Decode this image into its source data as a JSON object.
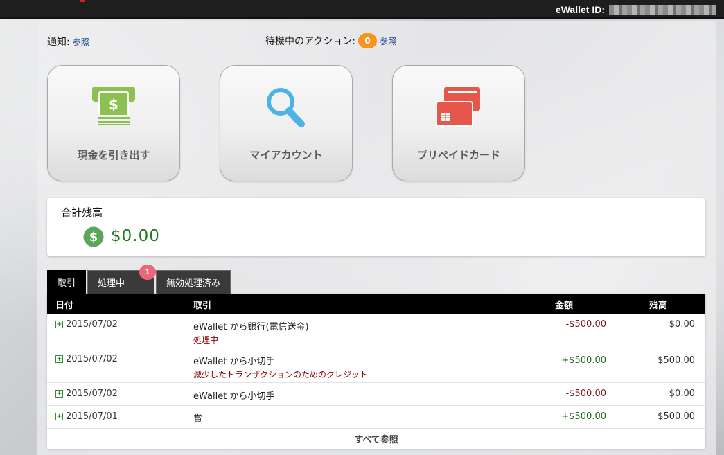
{
  "header": {
    "ewallet_id_label": "eWallet ID:"
  },
  "notices": {
    "notice_label": "通知:",
    "notice_link": "参照",
    "pending_label": "待機中のアクション:",
    "pending_count": "0",
    "pending_link": "参照"
  },
  "tiles": [
    {
      "label": "現金を引き出す",
      "icon": "atm-cash-icon",
      "color": "#8cc152"
    },
    {
      "label": "マイアカウント",
      "icon": "magnifier-icon",
      "color": "#4db3e6"
    },
    {
      "label": "プリペイドカード",
      "icon": "prepaid-card-icon",
      "color": "#e5574a"
    }
  ],
  "balance": {
    "title": "合計残高",
    "amount": "$0.00",
    "icon": "dollar-coin-icon"
  },
  "tabs": [
    {
      "label": "取引",
      "active": true
    },
    {
      "label": "処理中",
      "badge": "1"
    },
    {
      "label": "無効処理済み"
    }
  ],
  "table": {
    "columns": [
      "日付",
      "取引",
      "金額",
      "残高"
    ],
    "rows": [
      {
        "date": "2015/07/02",
        "desc": "eWallet から銀行(電信送金)",
        "sub": "処理中",
        "amount": "-$500.00",
        "balance": "$0.00"
      },
      {
        "date": "2015/07/02",
        "desc": "eWallet から小切手",
        "sub": "減少したトランザクションのためのクレジット",
        "amount": "+$500.00",
        "balance": "$500.00"
      },
      {
        "date": "2015/07/02",
        "desc": "eWallet から小切手",
        "sub": "",
        "amount": "-$500.00",
        "balance": "$0.00"
      },
      {
        "date": "2015/07/01",
        "desc": "賞",
        "sub": "",
        "amount": "+$500.00",
        "balance": "$500.00"
      }
    ],
    "footer": "すべて参照"
  }
}
